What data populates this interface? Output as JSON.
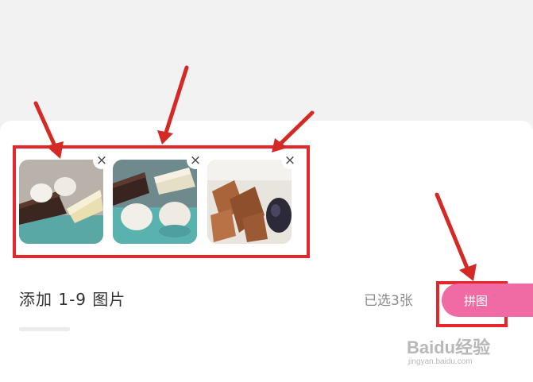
{
  "photos": [
    {
      "name": "photo-1",
      "subject": "cake slices with steamed buns"
    },
    {
      "name": "photo-2",
      "subject": "cake slices with steamed buns"
    },
    {
      "name": "photo-3",
      "subject": "fried chicken with dark sauce"
    }
  ],
  "remove_icon": "close-icon",
  "remove_symbol": "×",
  "add_label": "添加 1-9 图片",
  "selected_count": "已选3张",
  "collage_button": "拼图",
  "colors": {
    "accent": "#f06aa3",
    "annotation": "#e6262b",
    "sheet": "#ffffff",
    "backdrop": "#f2f2f3"
  },
  "watermark": {
    "brand": "Baidu经验",
    "url": "jingyan.baidu.com"
  }
}
